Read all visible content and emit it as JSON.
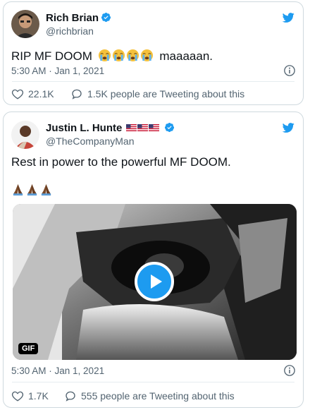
{
  "tweets": [
    {
      "name": "Rich Brian",
      "handle": "@richbrian",
      "text_prefix": "RIP MF DOOM",
      "text_suffix": "maaaaan.",
      "emoji_count": 4,
      "timestamp": "5:30 AM · Jan 1, 2021",
      "likes": "22.1K",
      "retweet_text": "1.5K people are Tweeting about this"
    },
    {
      "name": "Justin L. Hunte",
      "flags": 3,
      "handle": "@TheCompanyMan",
      "text": "Rest in power to the powerful MF DOOM.",
      "emoji_count": 3,
      "media_badge": "GIF",
      "timestamp": "5:30 AM · Jan 1, 2021",
      "likes": "1.7K",
      "retweet_text": "555 people are Tweeting about this"
    }
  ],
  "colors": {
    "brand": "#1d9bf0",
    "secondary_text": "#536471"
  }
}
